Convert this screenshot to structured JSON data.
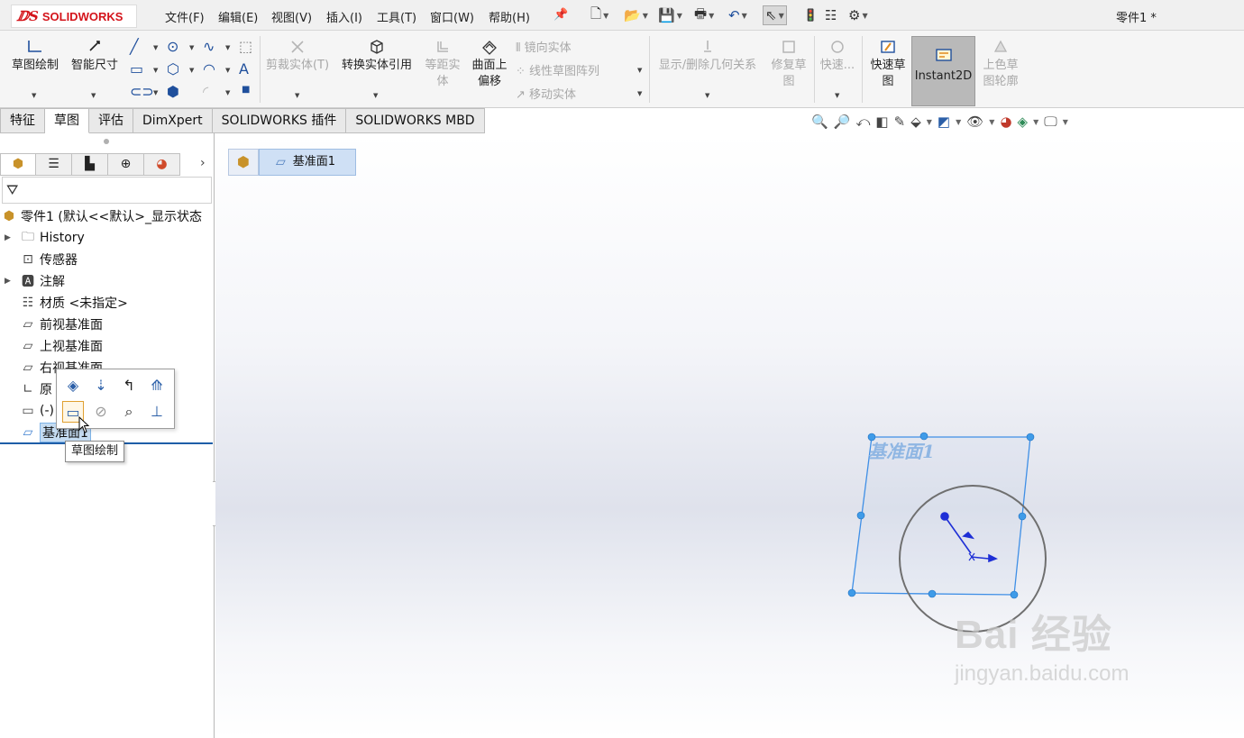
{
  "app": {
    "logo_ds": "ⅅS",
    "logo_name": "SOLIDWORKS",
    "doc_title": "零件1 *"
  },
  "menu": [
    "文件(F)",
    "编辑(E)",
    "视图(V)",
    "插入(I)",
    "工具(T)",
    "窗口(W)",
    "帮助(H)"
  ],
  "ribbon": {
    "sketch": "草图绘制",
    "smart_dim": "智能尺寸",
    "trim": "剪裁实体(T)",
    "convert": "转换实体引用",
    "offset_1": "等距实",
    "offset_2": "体",
    "surface_offset_1": "曲面上",
    "surface_offset_2": "偏移",
    "mirror": "镜向实体",
    "linear_pattern": "线性草图阵列",
    "move": "移动实体",
    "relations": "显示/删除几何关系",
    "repair_1": "修复草",
    "repair_2": "图",
    "quick_snaps": "快速...",
    "rapid_1": "快速草",
    "rapid_2": "图",
    "instant2d": "Instant2D",
    "shaded_1": "上色草",
    "shaded_2": "图轮廓"
  },
  "tabs": [
    "特征",
    "草图",
    "评估",
    "DimXpert",
    "SOLIDWORKS 插件",
    "SOLIDWORKS MBD"
  ],
  "active_tab": "草图",
  "tree": {
    "root": "零件1 (默认<<默认>_显示状态",
    "items": [
      {
        "label": "History",
        "icon": "history-folder-icon",
        "expandable": true
      },
      {
        "label": "传感器",
        "icon": "sensor-icon",
        "expandable": false
      },
      {
        "label": "注解",
        "icon": "annotations-icon",
        "expandable": true
      },
      {
        "label": "材质 <未指定>",
        "icon": "material-icon",
        "expandable": false
      },
      {
        "label": "前视基准面",
        "icon": "plane-icon",
        "expandable": false
      },
      {
        "label": "上视基准面",
        "icon": "plane-icon",
        "expandable": false
      },
      {
        "label": "右视基准面",
        "icon": "plane-icon",
        "expandable": false
      },
      {
        "label": "原",
        "icon": "origin-icon",
        "expandable": false
      },
      {
        "label": "(-)",
        "icon": "sketch-icon",
        "expandable": false
      },
      {
        "label": "基准面1",
        "icon": "plane-icon",
        "expandable": false
      }
    ]
  },
  "tooltip": "草图绘制",
  "breadcrumb": {
    "item": "基准面1"
  },
  "plane_label": "基准面1",
  "watermark": {
    "text": "Bai 经验",
    "sub": "jingyan.baidu.com"
  },
  "colors": {
    "selection_blue": "#3f8fe6",
    "plane_label": "#8fb6e3",
    "accent_red": "#d4141b"
  }
}
